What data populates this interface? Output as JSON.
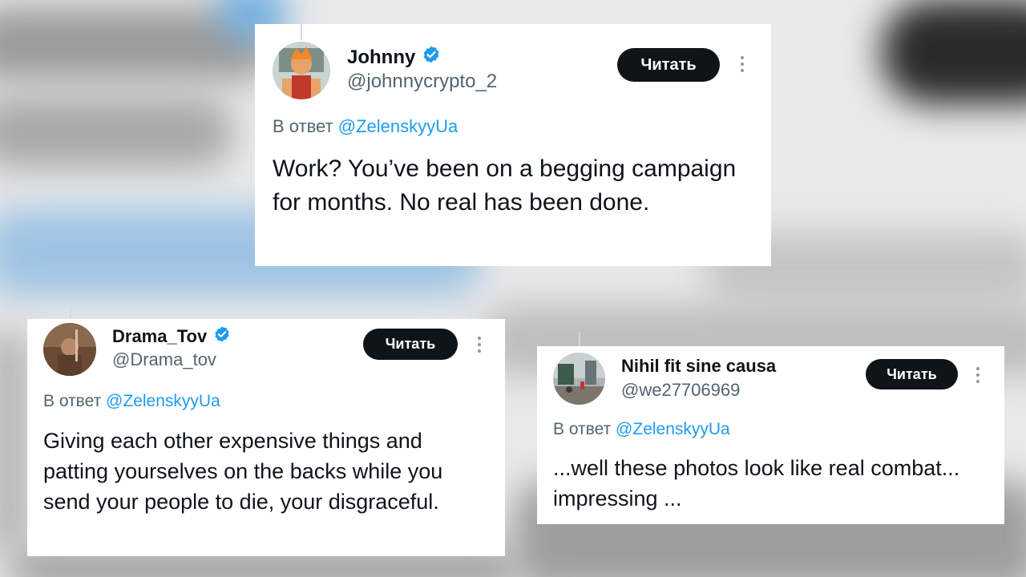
{
  "colors": {
    "accent": "#1d9bf0",
    "text": "#0f1419",
    "secondary": "#536471",
    "button_bg": "#0f1419",
    "verified": "#1d9bf0"
  },
  "posts": [
    {
      "name": "Johnny",
      "verified": true,
      "handle": "@johnnycrypto_2",
      "follow_label": "Читать",
      "reply_prefix": "В ответ",
      "reply_mention": "@ZelenskyyUa",
      "text": "Work? You’ve been on a begging campaign for months. No real has been done.",
      "icons": [
        "avatar",
        "verified-badge-icon",
        "more-options-icon"
      ]
    },
    {
      "name": "Drama_Tov",
      "verified": true,
      "handle": "@Drama_tov",
      "follow_label": "Читать",
      "reply_prefix": "В ответ",
      "reply_mention": "@ZelenskyyUa",
      "text": "Giving each other expensive things and patting yourselves on the backs while you send your people to die, your disgraceful.",
      "icons": [
        "avatar",
        "verified-badge-icon",
        "more-options-icon"
      ]
    },
    {
      "name": "Nihil fit sine causa",
      "verified": false,
      "handle": "@we27706969",
      "follow_label": "Читать",
      "reply_prefix": "В ответ",
      "reply_mention": "@ZelenskyyUa",
      "text": "...well these photos look like real combat... impressing ...",
      "icons": [
        "avatar",
        "more-options-icon"
      ]
    }
  ]
}
